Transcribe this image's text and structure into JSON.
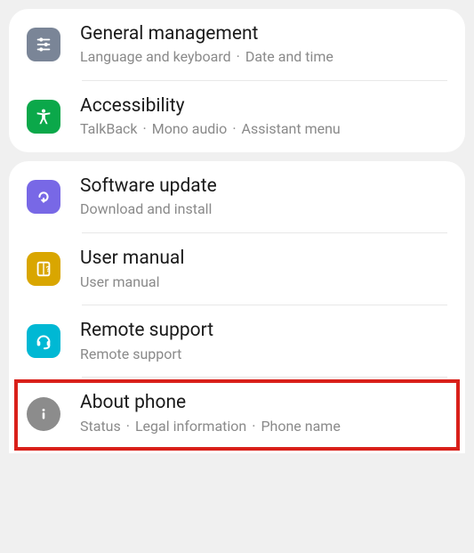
{
  "group1": {
    "items": [
      {
        "title": "General management",
        "subtitle_parts": [
          "Language and keyboard",
          "Date and time"
        ]
      },
      {
        "title": "Accessibility",
        "subtitle_parts": [
          "TalkBack",
          "Mono audio",
          "Assistant menu"
        ]
      }
    ]
  },
  "group2": {
    "items": [
      {
        "title": "Software update",
        "subtitle_parts": [
          "Download and install"
        ]
      },
      {
        "title": "User manual",
        "subtitle_parts": [
          "User manual"
        ]
      },
      {
        "title": "Remote support",
        "subtitle_parts": [
          "Remote support"
        ]
      },
      {
        "title": "About phone",
        "subtitle_parts": [
          "Status",
          "Legal information",
          "Phone name"
        ]
      }
    ]
  },
  "sep": "·"
}
